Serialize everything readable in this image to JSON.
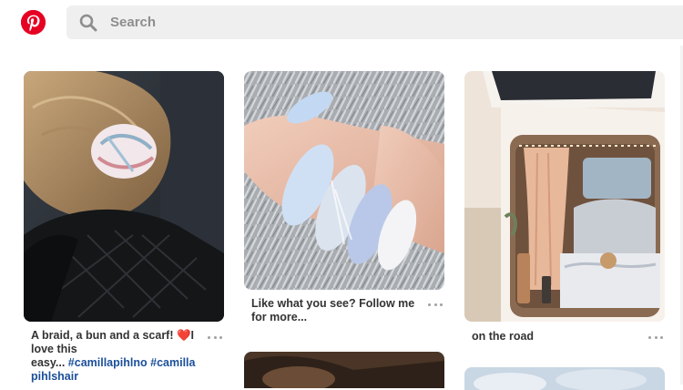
{
  "header": {
    "logo_icon": "pinterest-logo-icon",
    "search": {
      "icon": "search-icon",
      "placeholder": "Search"
    }
  },
  "pins": [
    {
      "description_text": "A braid, a bun and a scarf! ❤️I love this easy...",
      "description_lines": [
        "A braid, a bun and a scarf! ❤️I",
        "love this",
        "easy..."
      ],
      "hashtags": [
        "#camillapihlno",
        "#camilla",
        "pihlshair"
      ]
    },
    {
      "description_lines": [
        "Like what you see? Follow me",
        "for more..."
      ]
    },
    {
      "description_lines": [
        "on the road"
      ]
    }
  ],
  "colors": {
    "brand": "#e60023",
    "hashtag": "#1b4f9a",
    "search_bg": "#efefef"
  }
}
